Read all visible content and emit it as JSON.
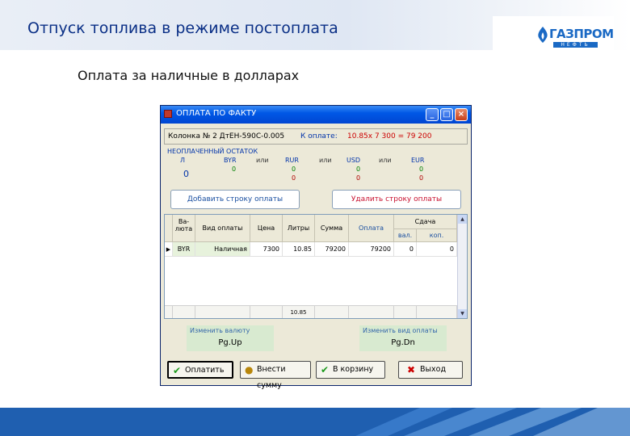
{
  "slide": {
    "title": "Отпуск топлива в режиме постоплата",
    "subtitle": "Оплата за наличные в долларах",
    "logo_main": "ГАЗПРОМ",
    "logo_sub": "НЕФТЬ"
  },
  "window": {
    "title": "ОПЛАТА ПО ФАКТУ",
    "minimize": "_",
    "maximize": "□",
    "close": "×",
    "column_info": "Колонка № 2 ДтЕН-590С-0.005",
    "pay_label": "К оплате:",
    "pay_value": "10.85x  7 300 =  79 200",
    "remaining": {
      "title": "НЕОПЛАЧЕННЫЙ ОСТАТОК",
      "col_l": "Л",
      "col_l_value": "0",
      "col_byr": "BYR",
      "col_byr_value": "0",
      "or1": "или",
      "col_rur": "RUR",
      "col_rur_value1": "0",
      "col_rur_value2": "0",
      "or2": "или",
      "col_usd": "USD",
      "col_usd_value1": "0",
      "col_usd_value2": "0",
      "or3": "или",
      "col_eur": "EUR",
      "col_eur_value1": "0",
      "col_eur_value2": "0"
    },
    "add_row_button": "Добавить строку оплаты",
    "delete_row_button": "Удалить строку оплаты",
    "grid": {
      "headers": {
        "currency_1": "Ва-",
        "currency_2": "люта",
        "pay_type": "Вид оплаты",
        "price": "Цена",
        "liters": "Литры",
        "sum": "Сумма",
        "payment": "Оплата",
        "change": "Сдача",
        "change_cur": "вал.",
        "change_coins": "коп."
      },
      "row": {
        "currency": "BYR",
        "pay_type": "Наличная",
        "price": "7300",
        "liters": "10.85",
        "sum": "79200",
        "payment": "79200",
        "change_cur": "0",
        "change_coins": "0"
      },
      "footer_liters": "10.85"
    },
    "hints": {
      "change_currency_label": "Изменить валюту",
      "change_currency_key": "Pg.Up",
      "change_pay_type_label": "Изменить вид оплаты",
      "change_pay_type_key": "Pg.Dn"
    },
    "buttons": {
      "pay": "Оплатить",
      "enter_sum": "Внести сумму",
      "to_basket": "В корзину",
      "exit": "Выход"
    }
  }
}
